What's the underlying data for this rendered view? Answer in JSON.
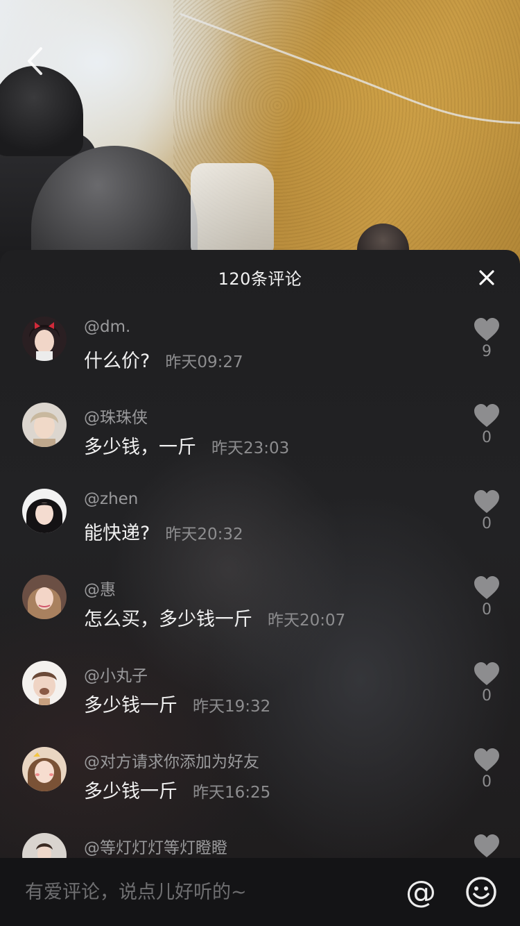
{
  "video": {
    "back_icon": "chevron-left-icon"
  },
  "panel": {
    "title": "120条评论",
    "close_icon": "close-icon"
  },
  "comments": [
    {
      "username": "@dm.",
      "text": "什么价?",
      "time": "昨天09:27",
      "likes": "9"
    },
    {
      "username": "@珠珠侠",
      "text": "多少钱，一斤",
      "time": "昨天23:03",
      "likes": "0"
    },
    {
      "username": "@zhen",
      "text": "能快递?",
      "time": "昨天20:32",
      "likes": "0"
    },
    {
      "username": "@惠",
      "text": "怎么买，多少钱一斤",
      "time": "昨天20:07",
      "likes": "0"
    },
    {
      "username": "@小丸子",
      "text": "多少钱一斤",
      "time": "昨天19:32",
      "likes": "0"
    },
    {
      "username": "@对方请求你添加为好友",
      "text": "多少钱一斤",
      "time": "昨天16:25",
      "likes": "0"
    },
    {
      "username": "@等灯灯灯等灯瞪瞪",
      "text": "",
      "time": "",
      "likes": ""
    }
  ],
  "input": {
    "placeholder": "有爱评论，说点儿好听的~",
    "mention_label": "@",
    "emoji_icon": "smiley-icon"
  }
}
